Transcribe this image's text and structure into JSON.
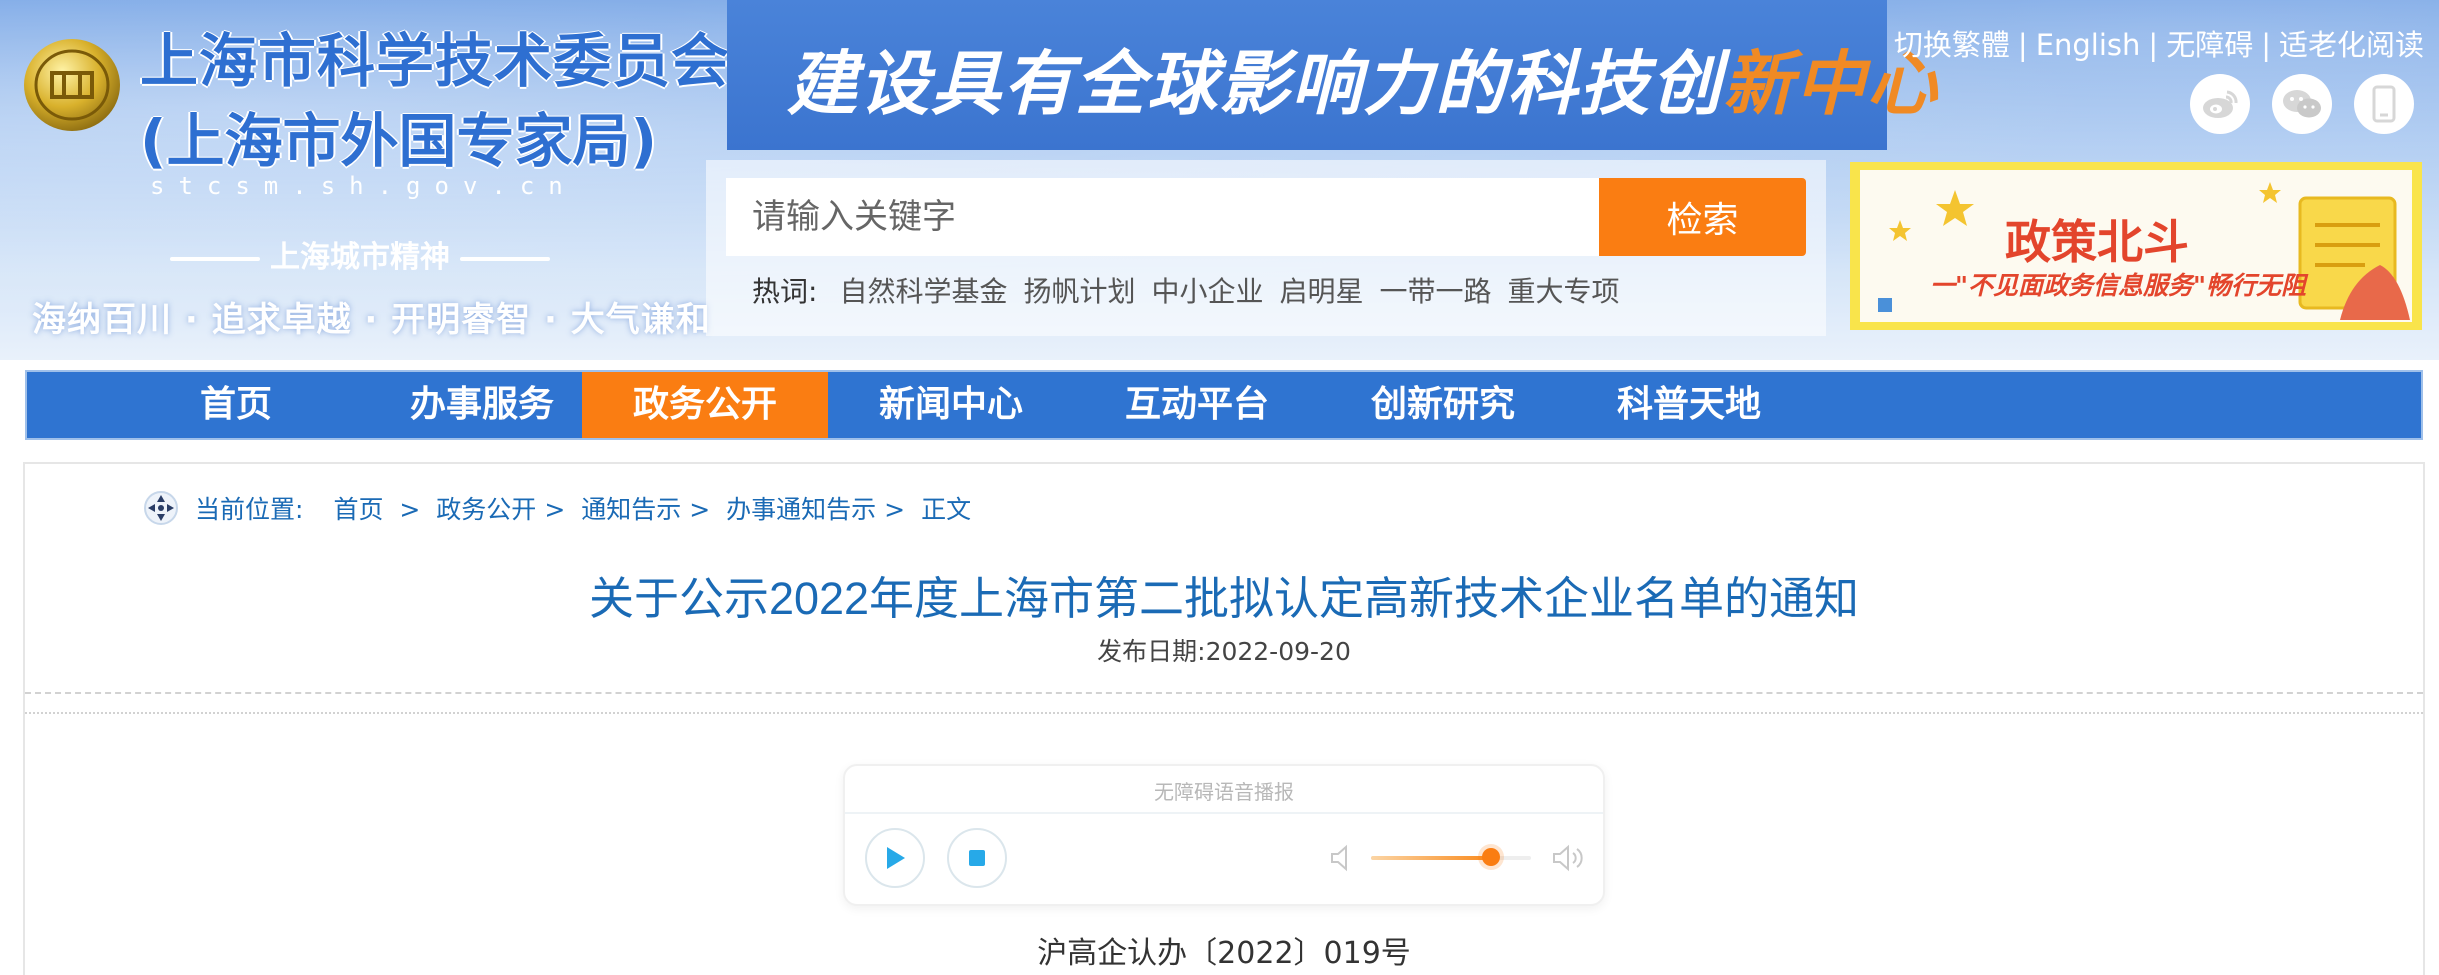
{
  "header": {
    "site_title": "上海市科学技术委员会",
    "site_subtitle": "(上海市外国专家局)",
    "site_domain": "stcsm.sh.gov.cn",
    "spirit_title": "上海城市精神",
    "spirit_motto": "海纳百川 · 追求卓越 · 开明睿智 · 大气谦和",
    "banner_prefix": "建设具有全球影响力的科技创",
    "banner_accent": "新中心",
    "top_links": [
      "切换繁體",
      "English",
      "无障碍",
      "适老化阅读"
    ],
    "social_icons": [
      "weibo-icon",
      "wechat-icon",
      "mobile-icon"
    ]
  },
  "search": {
    "placeholder": "请输入关键字",
    "button_label": "检索",
    "hot_label": "热词:",
    "hot_words": [
      "自然科学基金",
      "扬帆计划",
      "中小企业",
      "启明星",
      "一带一路",
      "重大专项"
    ]
  },
  "promo": {
    "title": "政策北斗",
    "subtitle": "一\"不见面政务信息服务\"畅行无阻"
  },
  "nav": {
    "items": [
      "首页",
      "办事服务",
      "政务公开",
      "新闻中心",
      "互动平台",
      "创新研究",
      "科普天地"
    ],
    "active_index": 2
  },
  "breadcrumb": {
    "label": "当前位置:",
    "items": [
      "首页",
      "政务公开",
      "通知告示",
      "办事通知告示",
      "正文"
    ],
    "separators": [
      " > ",
      "> ",
      "> ",
      "> "
    ]
  },
  "article": {
    "title": "关于公示2022年度上海市第二批拟认定高新技术企业名单的通知",
    "date_label": "发布日期:",
    "date": "2022-09-20",
    "doc_number": "沪高企认办〔2022〕019号"
  },
  "player": {
    "title": "无障碍语音播报",
    "volume": 0.75
  },
  "colors": {
    "accent": "#fa7d12",
    "nav_bg": "#2f74d1",
    "link": "#1a6ab5"
  }
}
